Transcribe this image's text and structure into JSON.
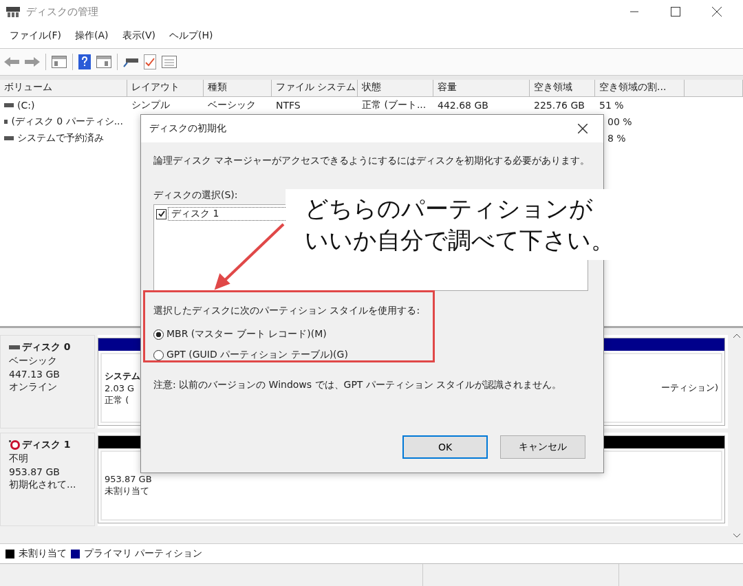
{
  "window": {
    "title": "ディスクの管理"
  },
  "menu": [
    "ファイル(F)",
    "操作(A)",
    "表示(V)",
    "ヘルプ(H)"
  ],
  "volume_table": {
    "columns": [
      "ボリューム",
      "レイアウト",
      "種類",
      "ファイル システム",
      "状態",
      "容量",
      "空き領域",
      "空き領域の割..."
    ],
    "rows": [
      {
        "volume": "(C:)",
        "layout": "シンプル",
        "type": "ベーシック",
        "file_system": "NTFS",
        "status": "正常 (ブート...",
        "capacity": "442.68 GB",
        "free": "225.76 GB",
        "free_pct": "51 %"
      },
      {
        "volume": "(ディスク 0 パーティシ...",
        "free_pct": "00 %"
      },
      {
        "volume": "システムで予約済み",
        "free_pct": "8 %"
      }
    ]
  },
  "disks": [
    {
      "name": "ディスク 0",
      "kind": "online",
      "lines": [
        "ベーシック",
        "447.13 GB",
        "オンライン"
      ],
      "partitions": [
        {
          "color": "#00008b",
          "lines": [
            "システム",
            "2.03 G",
            "正常 ("
          ]
        },
        {
          "color": "#00008b",
          "lines": [
            "ーティション)"
          ]
        }
      ]
    },
    {
      "name": "ディスク 1",
      "kind": "uninitialized",
      "lines": [
        "不明",
        "953.87 GB",
        "初期化されて..."
      ],
      "partitions": [
        {
          "color": "#000000",
          "lines": [
            "953.87 GB",
            "未割り当て"
          ]
        }
      ]
    }
  ],
  "legend": [
    {
      "label": "未割り当て",
      "color": "#000000"
    },
    {
      "label": "プライマリ パーティション",
      "color": "#00008b"
    }
  ],
  "dialog": {
    "title": "ディスクの初期化",
    "message": "論理ディスク マネージャーがアクセスできるようにするにはディスクを初期化する必要があります。",
    "select_label": "ディスクの選択(S):",
    "disks": [
      {
        "label": "ディスク 1",
        "checked": true
      }
    ],
    "style_label": "選択したディスクに次のパーティション スタイルを使用する:",
    "options": [
      {
        "label": "MBR (マスター ブート レコード)(M)",
        "selected": true
      },
      {
        "label": "GPT (GUID パーティション テーブル)(G)",
        "selected": false
      }
    ],
    "note": "注意: 以前のバージョンの Windows では、GPT パーティション スタイルが認識されません。",
    "buttons": [
      {
        "label": "OK",
        "default": true
      },
      {
        "label": "キャンセル",
        "default": false
      }
    ]
  },
  "annotation": {
    "lines": [
      "どちらのパーティションが",
      "いいか自分で調べて下さい。"
    ]
  }
}
